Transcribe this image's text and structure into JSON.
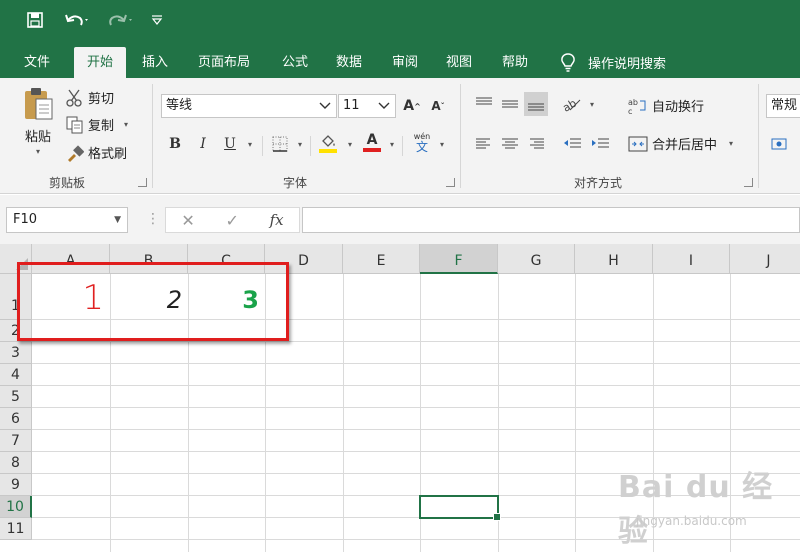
{
  "ribbon_tabs": [
    "文件",
    "开始",
    "插入",
    "页面布局",
    "公式",
    "数据",
    "审阅",
    "视图",
    "帮助"
  ],
  "tell_me": "操作说明搜索",
  "clipboard": {
    "paste": "粘贴",
    "cut": "剪切",
    "copy": "复制",
    "format_painter": "格式刷",
    "group_label": "剪贴板"
  },
  "font": {
    "name": "等线",
    "size": "11",
    "bold": "B",
    "italic": "I",
    "underline": "U",
    "grow": "A",
    "shrink": "A",
    "phonetic_top": "wén",
    "phonetic_bottom": "文",
    "group_label": "字体",
    "highlight_color": "#FFE100",
    "font_color": "#E02020"
  },
  "alignment": {
    "wrap_text": "自动换行",
    "merge_center": "合并后居中",
    "group_label": "对齐方式"
  },
  "number": {
    "format": "常规"
  },
  "formula_bar": {
    "name_box": "F10",
    "cancel": "✕",
    "enter": "✓",
    "fx": "fx",
    "value": ""
  },
  "sheet": {
    "columns": [
      "A",
      "B",
      "C",
      "D",
      "E",
      "F",
      "G",
      "H",
      "I",
      "J"
    ],
    "rows": [
      "1",
      "2",
      "3",
      "4",
      "5",
      "6",
      "7",
      "8",
      "9",
      "10",
      "11"
    ],
    "selected_cell": "F10",
    "cells": {
      "A1": {
        "value": "1",
        "color": "#E02020"
      },
      "B1": {
        "value": "2",
        "color": "#222222"
      },
      "C1": {
        "value": "3",
        "color": "#1AA34A"
      }
    }
  },
  "watermark": {
    "logo": "Bai du 经验",
    "url": "jingyan.baidu.com"
  }
}
